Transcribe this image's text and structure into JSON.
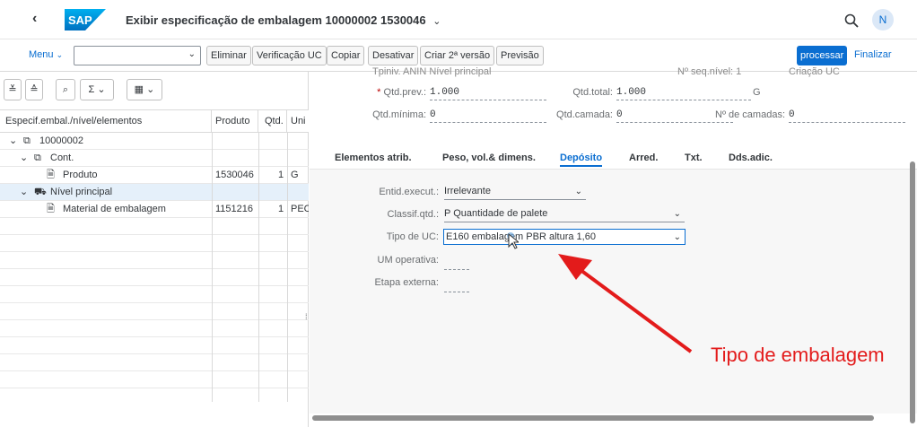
{
  "header": {
    "back_glyph": "‹",
    "logo_text": "SAP",
    "title": "Exibir especificação de embalagem 10000002 1530046",
    "title_chevron": "⌄",
    "avatar_initial": "N"
  },
  "toolbar": {
    "menu_label": "Menu",
    "menu_select_value": "",
    "buttons": [
      "Eliminar",
      "Verificação UC",
      "Copiar",
      "Desativar",
      "Criar 2ª versão",
      "Previsão"
    ],
    "primary_label": "processar",
    "finalizar_label": "Finalizar"
  },
  "tree": {
    "toolbar_glyphs": [
      "≚",
      "≙",
      "⌕",
      "Σ",
      "▦"
    ],
    "columns": [
      "Especif.embal./nível/elementos",
      "Produto",
      "Qtd.",
      "Uni"
    ],
    "rows": [
      {
        "label": "10000002",
        "produto": "",
        "qtd": "",
        "uni": "",
        "expander": "⌄",
        "icon": "package-icon"
      },
      {
        "label": "Cont.",
        "produto": "",
        "qtd": "",
        "uni": "",
        "expander": "⌄",
        "icon": "package-icon"
      },
      {
        "label": "Produto",
        "produto": "1530046",
        "qtd": "1",
        "uni": "G",
        "expander": "",
        "icon": "document-icon"
      },
      {
        "label": "Nível principal",
        "produto": "",
        "qtd": "",
        "uni": "",
        "expander": "⌄",
        "icon": "truck-icon"
      },
      {
        "label": "Material de embalagem",
        "produto": "1151216",
        "qtd": "1",
        "uni": "PEC",
        "expander": "",
        "icon": "document-icon"
      }
    ]
  },
  "form": {
    "top_cut_left": "Tpiniv.   ANIN   Nível principal",
    "top_cut_mid": "Nº seq.nível:   1",
    "top_cut_right": "Criação UC",
    "qtd_prev_label": "Qtd.prev.:",
    "qtd_prev_value": "1.000",
    "qtd_total_label": "Qtd.total:",
    "qtd_total_value": "1.000",
    "qtd_total_unit": "G",
    "qtd_minima_label": "Qtd.mínima:",
    "qtd_minima_value": "0",
    "qtd_camada_label": "Qtd.camada:",
    "qtd_camada_value": "0",
    "num_camadas_label": "Nº de camadas:",
    "num_camadas_value": "0"
  },
  "tabs": [
    "Elementos atrib.",
    "Peso, vol.& dimens.",
    "Depósito",
    "Arred.",
    "Txt.",
    "Dds.adic."
  ],
  "active_tab": "Depósito",
  "deposito": {
    "entid_label": "Entid.execut.:",
    "entid_value": "Irrelevante",
    "classif_label": "Classif.qtd.:",
    "classif_value": "P Quantidade de palete",
    "tipo_uc_label": "Tipo de UC:",
    "tipo_uc_value": "E160 embalagem PBR altura 1,60",
    "um_operativa_label": "UM operativa:",
    "etapa_label": "Etapa externa:"
  },
  "annotation": {
    "text": "Tipo de embalagem",
    "color": "#e31b1b"
  },
  "colors": {
    "accent": "#0a6ed1",
    "selected_row": "#e5f0fa"
  }
}
